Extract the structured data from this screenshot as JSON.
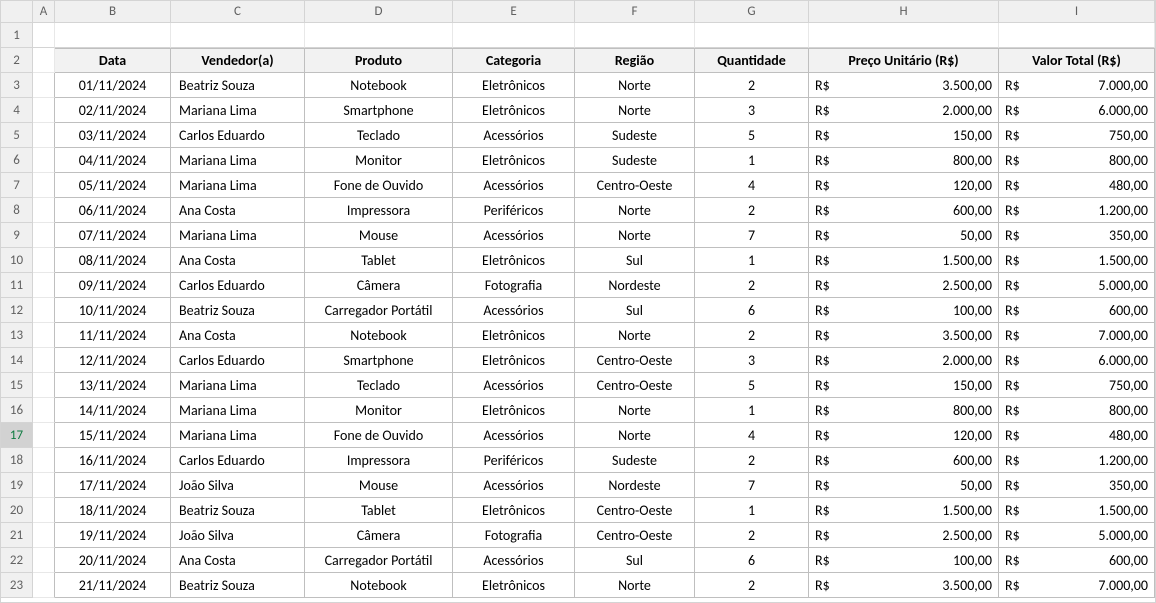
{
  "columns": [
    "A",
    "B",
    "C",
    "D",
    "E",
    "F",
    "G",
    "H",
    "I"
  ],
  "colWidths": {
    "A": 22,
    "B": 116,
    "C": 134,
    "D": 148,
    "E": 122,
    "F": 120,
    "G": 114,
    "H": 190,
    "I": 156
  },
  "selectedRow": 17,
  "headers": {
    "data": "Data",
    "vendedor": "Vendedor(a)",
    "produto": "Produto",
    "categoria": "Categoria",
    "regiao": "Região",
    "quantidade": "Quantidade",
    "preco": "Preço Unitário (R$)",
    "total": "Valor Total (R$)"
  },
  "currency": "R$",
  "rows": [
    {
      "data": "01/11/2024",
      "vendedor": "Beatriz Souza",
      "produto": "Notebook",
      "categoria": "Eletrônicos",
      "regiao": "Norte",
      "quantidade": "2",
      "preco": "3.500,00",
      "total": "7.000,00"
    },
    {
      "data": "02/11/2024",
      "vendedor": "Mariana Lima",
      "produto": "Smartphone",
      "categoria": "Eletrônicos",
      "regiao": "Norte",
      "quantidade": "3",
      "preco": "2.000,00",
      "total": "6.000,00"
    },
    {
      "data": "03/11/2024",
      "vendedor": "Carlos Eduardo",
      "produto": "Teclado",
      "categoria": "Acessórios",
      "regiao": "Sudeste",
      "quantidade": "5",
      "preco": "150,00",
      "total": "750,00"
    },
    {
      "data": "04/11/2024",
      "vendedor": "Mariana Lima",
      "produto": "Monitor",
      "categoria": "Eletrônicos",
      "regiao": "Sudeste",
      "quantidade": "1",
      "preco": "800,00",
      "total": "800,00"
    },
    {
      "data": "05/11/2024",
      "vendedor": "Mariana Lima",
      "produto": "Fone de Ouvido",
      "categoria": "Acessórios",
      "regiao": "Centro-Oeste",
      "quantidade": "4",
      "preco": "120,00",
      "total": "480,00"
    },
    {
      "data": "06/11/2024",
      "vendedor": "Ana Costa",
      "produto": "Impressora",
      "categoria": "Periféricos",
      "regiao": "Norte",
      "quantidade": "2",
      "preco": "600,00",
      "total": "1.200,00"
    },
    {
      "data": "07/11/2024",
      "vendedor": "Mariana Lima",
      "produto": "Mouse",
      "categoria": "Acessórios",
      "regiao": "Norte",
      "quantidade": "7",
      "preco": "50,00",
      "total": "350,00"
    },
    {
      "data": "08/11/2024",
      "vendedor": "Ana Costa",
      "produto": "Tablet",
      "categoria": "Eletrônicos",
      "regiao": "Sul",
      "quantidade": "1",
      "preco": "1.500,00",
      "total": "1.500,00"
    },
    {
      "data": "09/11/2024",
      "vendedor": "Carlos Eduardo",
      "produto": "Câmera",
      "categoria": "Fotografia",
      "regiao": "Nordeste",
      "quantidade": "2",
      "preco": "2.500,00",
      "total": "5.000,00"
    },
    {
      "data": "10/11/2024",
      "vendedor": "Beatriz Souza",
      "produto": "Carregador Portátil",
      "categoria": "Acessórios",
      "regiao": "Sul",
      "quantidade": "6",
      "preco": "100,00",
      "total": "600,00"
    },
    {
      "data": "11/11/2024",
      "vendedor": "Ana Costa",
      "produto": "Notebook",
      "categoria": "Eletrônicos",
      "regiao": "Norte",
      "quantidade": "2",
      "preco": "3.500,00",
      "total": "7.000,00"
    },
    {
      "data": "12/11/2024",
      "vendedor": "Carlos Eduardo",
      "produto": "Smartphone",
      "categoria": "Eletrônicos",
      "regiao": "Centro-Oeste",
      "quantidade": "3",
      "preco": "2.000,00",
      "total": "6.000,00"
    },
    {
      "data": "13/11/2024",
      "vendedor": "Mariana Lima",
      "produto": "Teclado",
      "categoria": "Acessórios",
      "regiao": "Centro-Oeste",
      "quantidade": "5",
      "preco": "150,00",
      "total": "750,00"
    },
    {
      "data": "14/11/2024",
      "vendedor": "Mariana Lima",
      "produto": "Monitor",
      "categoria": "Eletrônicos",
      "regiao": "Norte",
      "quantidade": "1",
      "preco": "800,00",
      "total": "800,00"
    },
    {
      "data": "15/11/2024",
      "vendedor": "Mariana Lima",
      "produto": "Fone de Ouvido",
      "categoria": "Acessórios",
      "regiao": "Norte",
      "quantidade": "4",
      "preco": "120,00",
      "total": "480,00"
    },
    {
      "data": "16/11/2024",
      "vendedor": "Carlos Eduardo",
      "produto": "Impressora",
      "categoria": "Periféricos",
      "regiao": "Sudeste",
      "quantidade": "2",
      "preco": "600,00",
      "total": "1.200,00"
    },
    {
      "data": "17/11/2024",
      "vendedor": "João Silva",
      "produto": "Mouse",
      "categoria": "Acessórios",
      "regiao": "Nordeste",
      "quantidade": "7",
      "preco": "50,00",
      "total": "350,00"
    },
    {
      "data": "18/11/2024",
      "vendedor": "Beatriz Souza",
      "produto": "Tablet",
      "categoria": "Eletrônicos",
      "regiao": "Centro-Oeste",
      "quantidade": "1",
      "preco": "1.500,00",
      "total": "1.500,00"
    },
    {
      "data": "19/11/2024",
      "vendedor": "João Silva",
      "produto": "Câmera",
      "categoria": "Fotografia",
      "regiao": "Centro-Oeste",
      "quantidade": "2",
      "preco": "2.500,00",
      "total": "5.000,00"
    },
    {
      "data": "20/11/2024",
      "vendedor": "Ana Costa",
      "produto": "Carregador Portátil",
      "categoria": "Acessórios",
      "regiao": "Sul",
      "quantidade": "6",
      "preco": "100,00",
      "total": "600,00"
    },
    {
      "data": "21/11/2024",
      "vendedor": "Beatriz Souza",
      "produto": "Notebook",
      "categoria": "Eletrônicos",
      "regiao": "Norte",
      "quantidade": "2",
      "preco": "3.500,00",
      "total": "7.000,00"
    }
  ]
}
